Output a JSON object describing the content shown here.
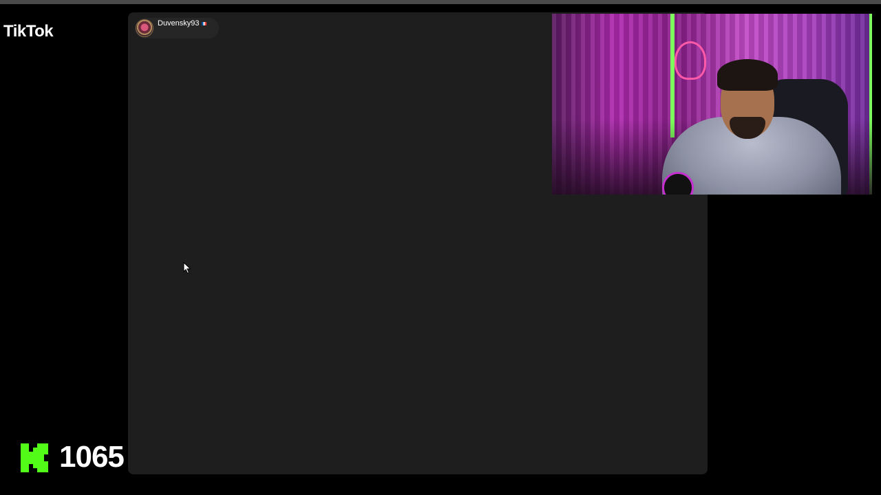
{
  "app": {
    "brand": "TikTok"
  },
  "stream": {
    "username": "Duvensky93",
    "flag": "fr-flag-icon"
  },
  "overlay": {
    "kick_count": "1065",
    "kick_color": "#53fc18"
  },
  "colors": {
    "panel_bg": "#1e1e1e",
    "page_bg": "#000000"
  }
}
